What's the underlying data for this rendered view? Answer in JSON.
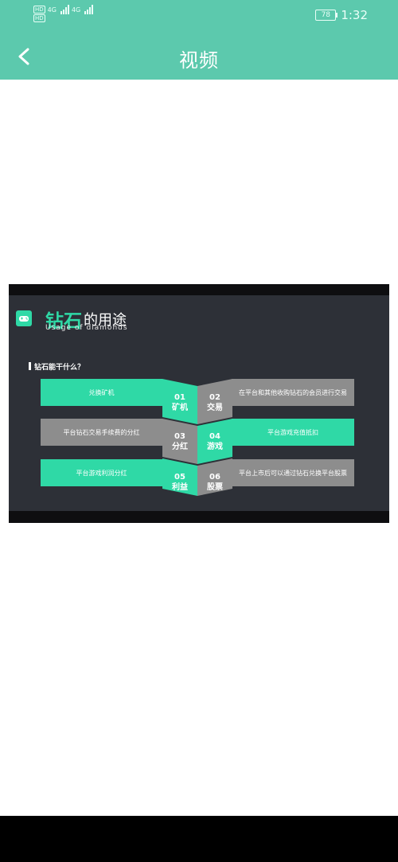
{
  "status_bar": {
    "hd1": "HD",
    "hd2": "HD",
    "net1": "4G",
    "net2": "4G",
    "battery": "78",
    "time": "1:32"
  },
  "header": {
    "title": "视频"
  },
  "slide": {
    "title_highlight": "钻石",
    "title_rest": "的用途",
    "subtitle": "Usage of diamonds",
    "question": "钻石能干什么？",
    "left_items": [
      "兑换矿机",
      "平台钻石交易手续费的分红",
      "平台游戏利润分红"
    ],
    "right_items": [
      "在平台和其他收购钻石的会员进行交易",
      "平台游戏充值抵扣",
      "平台上市后可以通过钻石兑换平台股票"
    ],
    "chevrons": [
      {
        "number": "01",
        "label": "矿机"
      },
      {
        "number": "02",
        "label": "交易"
      },
      {
        "number": "03",
        "label": "分红"
      },
      {
        "number": "04",
        "label": "游戏"
      },
      {
        "number": "05",
        "label": "利益"
      },
      {
        "number": "06",
        "label": "股票"
      }
    ]
  },
  "colors": {
    "header": "#5cc9ad",
    "accent": "#2fd9a6",
    "gray": "#8d8d8d",
    "slide_bg": "#2d3037"
  }
}
